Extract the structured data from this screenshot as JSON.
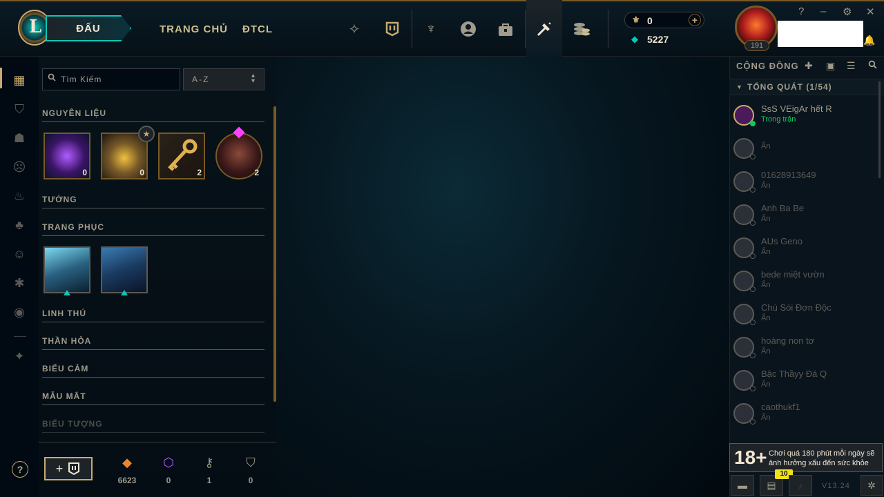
{
  "topbar": {
    "play_label": "ĐẤU",
    "logo_letter": "L",
    "nav": [
      "TRANG CHỦ",
      "ĐTCL"
    ],
    "icons": [
      "prestige-icon",
      "collection-icon",
      "tft-icon",
      "profile-icon",
      "store-icon",
      "crafting-icon",
      "currency-stack-icon"
    ],
    "rp_value": "0",
    "be_value": "5227",
    "level": "191",
    "window_controls": [
      "?",
      "–",
      "⚙",
      "✕"
    ]
  },
  "rail": {
    "icons": [
      "grid-icon",
      "collection-icon",
      "helmet-icon",
      "mask-icon",
      "ward-icon",
      "flame-icon",
      "emote-icon",
      "eternals-icon",
      "profile-circle-icon",
      "sparkle-icon"
    ]
  },
  "collection": {
    "search_placeholder": "Tìm Kiếm",
    "sort_value": "A-Z",
    "sections": {
      "materials": "NGUYÊN LIỆU",
      "champions": "TƯỚNG",
      "skins": "TRANG PHỤC",
      "companions": "LINH THÚ",
      "wards": "THẦN HỎA",
      "emotes": "BIỂU CẢM",
      "eyes": "MẪU MẮT",
      "icons": "BIỂU TƯỢNG"
    },
    "materials": [
      {
        "name": "mythic-essence",
        "count": "0"
      },
      {
        "name": "hextech-chest",
        "count": "0"
      },
      {
        "name": "key",
        "count": "2"
      },
      {
        "name": "champion-shard",
        "count": "2"
      }
    ]
  },
  "resources": [
    {
      "icon": "orange-essence-icon",
      "value": "6623",
      "color": "#e8862c"
    },
    {
      "icon": "mythic-essence-icon",
      "value": "0",
      "color": "#b05cff"
    },
    {
      "icon": "key-fragment-icon",
      "value": "1",
      "color": "#a09b8c"
    },
    {
      "icon": "chest-icon",
      "value": "0",
      "color": "#a09b8c"
    }
  ],
  "help_label": "?",
  "craft_label": "+",
  "social": {
    "title": "CỘNG ĐỒNG",
    "group": "TỔNG QUÁT (1/54)",
    "friends": [
      {
        "name": "SsS VEigAr hết R",
        "status": "Trong trận",
        "online": true
      },
      {
        "name": "",
        "status": "Ẩn",
        "online": false
      },
      {
        "name": "01628913649",
        "status": "Ẩn",
        "online": false
      },
      {
        "name": "Anh Ba Be",
        "status": "Ẩn",
        "online": false
      },
      {
        "name": "AUs Geno",
        "status": "Ẩn",
        "online": false
      },
      {
        "name": "bede miệt vườn",
        "status": "Ẩn",
        "online": false
      },
      {
        "name": "Chú Sói Đơn Độc",
        "status": "Ẩn",
        "online": false
      },
      {
        "name": "hoàng non tơ",
        "status": "Ẩn",
        "online": false
      },
      {
        "name": "Bậc Thầyy Đá Q",
        "status": "Ẩn",
        "online": false
      },
      {
        "name": "caothukf1",
        "status": "Ẩn",
        "online": false
      }
    ],
    "warning_age": "18+",
    "warning_text": "Chơi quá 180 phút mỗi ngày sẽ ảnh hưởng xấu đến sức khỏe",
    "notif_count": "10",
    "version": "V13.24"
  },
  "colors": {
    "gold": "#c8aa6e",
    "teal": "#0ac8b9",
    "online_green": "#0acb64"
  }
}
